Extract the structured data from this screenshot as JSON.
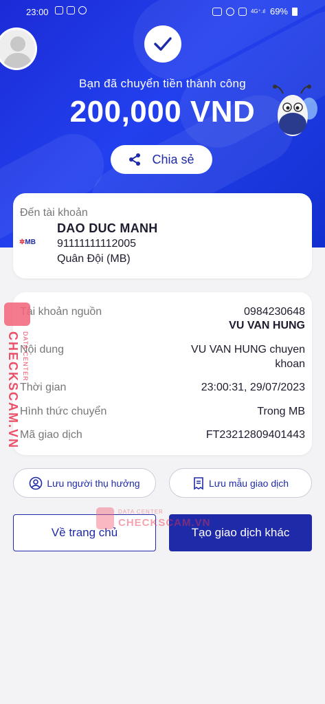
{
  "status_bar": {
    "time": "23:00",
    "battery": "69%"
  },
  "hero": {
    "success_message": "Bạn đã chuyển tiền thành công",
    "amount": "200,000 VND",
    "share_label": "Chia sẻ"
  },
  "destination": {
    "title": "Đến tài khoản",
    "bank_logo": "MB",
    "name": "DAO DUC MANH",
    "account_number": "91111111112005",
    "bank_name": "Quân Đội (MB)"
  },
  "details": {
    "source_label": "Tài khoản nguồn",
    "source_account": "0984230648",
    "source_name": "VU VAN HUNG",
    "content_label": "Nội dung",
    "content_value_line1": "VU VAN HUNG chuyen",
    "content_value_line2": "khoan",
    "time_label": "Thời gian",
    "time_value": "23:00:31, 29/07/2023",
    "method_label": "Hình thức chuyển",
    "method_value": "Trong MB",
    "txn_label": "Mã giao dịch",
    "txn_value": "FT23212809401443"
  },
  "actions": {
    "save_recipient": "Lưu người thụ hưởng",
    "save_template": "Lưu mẫu giao dịch",
    "home": "Về trang chủ",
    "new_transaction": "Tạo giao dịch khác"
  },
  "watermark": {
    "brand": "CHECKSCAM.VN",
    "sub": "DATA CENTER"
  },
  "colors": {
    "primary": "#1e2aa8",
    "hero_blue": "#2340ee",
    "watermark": "#e8334f"
  }
}
